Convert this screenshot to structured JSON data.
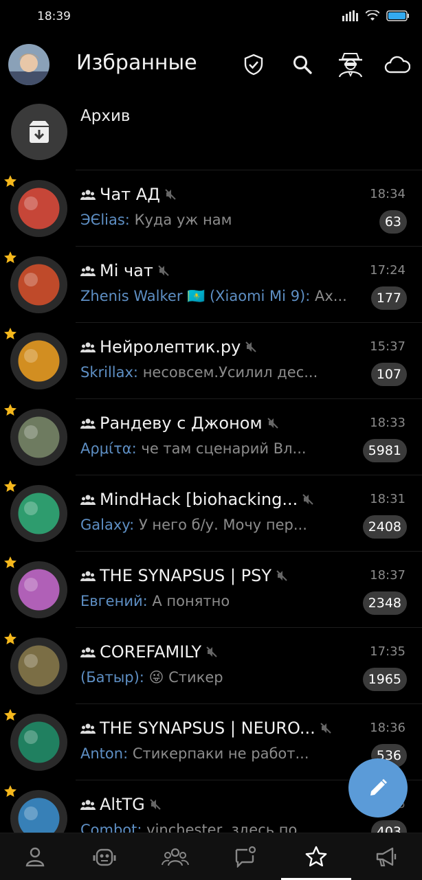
{
  "status": {
    "time": "18:39"
  },
  "header": {
    "title": "Избранные"
  },
  "archive": {
    "label": "Архив"
  },
  "chats": [
    {
      "name": "Чат АД",
      "sender": "ЭЄlias:",
      "message": "Куда уж нам",
      "time": "18:34",
      "unread": "63",
      "accent": "#e24b3b"
    },
    {
      "name": "Mi чат",
      "sender": "Zhenis Walker 🇰🇿 (Xiaomi Mi 9):",
      "message": "Ах...",
      "time": "17:24",
      "unread": "177",
      "accent": "#d9502a"
    },
    {
      "name": "Нейролептик.ру",
      "sender": "Skrillax:",
      "message": "несовсем.Усилил дес...",
      "time": "15:37",
      "unread": "107",
      "accent": "#f0a020"
    },
    {
      "name": "Рандеву с Джоном",
      "sender": "Αρμίτα:",
      "message": "че там сценарий Вл...",
      "time": "18:33",
      "unread": "5981",
      "accent": "#7a8a6a"
    },
    {
      "name": "MindHack [biohacking...",
      "sender": "Galaxy:",
      "message": "У него б/у. Мочу пер...",
      "time": "18:31",
      "unread": "2408",
      "accent": "#2fb07a"
    },
    {
      "name": "THE SYNAPSUS | PSY",
      "sender": "Евгений:",
      "message": "А понятно",
      "time": "18:37",
      "unread": "2348",
      "accent": "#c86ad0"
    },
    {
      "name": "COREFAMILY",
      "sender": "(Батыр):",
      "message": "😜 Стикер",
      "time": "17:35",
      "unread": "1965",
      "accent": "#8a7a4a"
    },
    {
      "name": "THE SYNAPSUS | NEURO...",
      "sender": "Anton:",
      "message": "Стикерпаки не работ...",
      "time": "18:36",
      "unread": "536",
      "accent": "#1f8f6a"
    },
    {
      "name": "AltTG",
      "sender": "Combot:",
      "message": "vinchester, здесь по...",
      "time": "18:35",
      "unread": "403",
      "accent": "#3a8fd0"
    }
  ],
  "colors": {
    "fab": "#5b9bd8",
    "star": "#f5b81c",
    "sender": "#5e8fc4"
  }
}
